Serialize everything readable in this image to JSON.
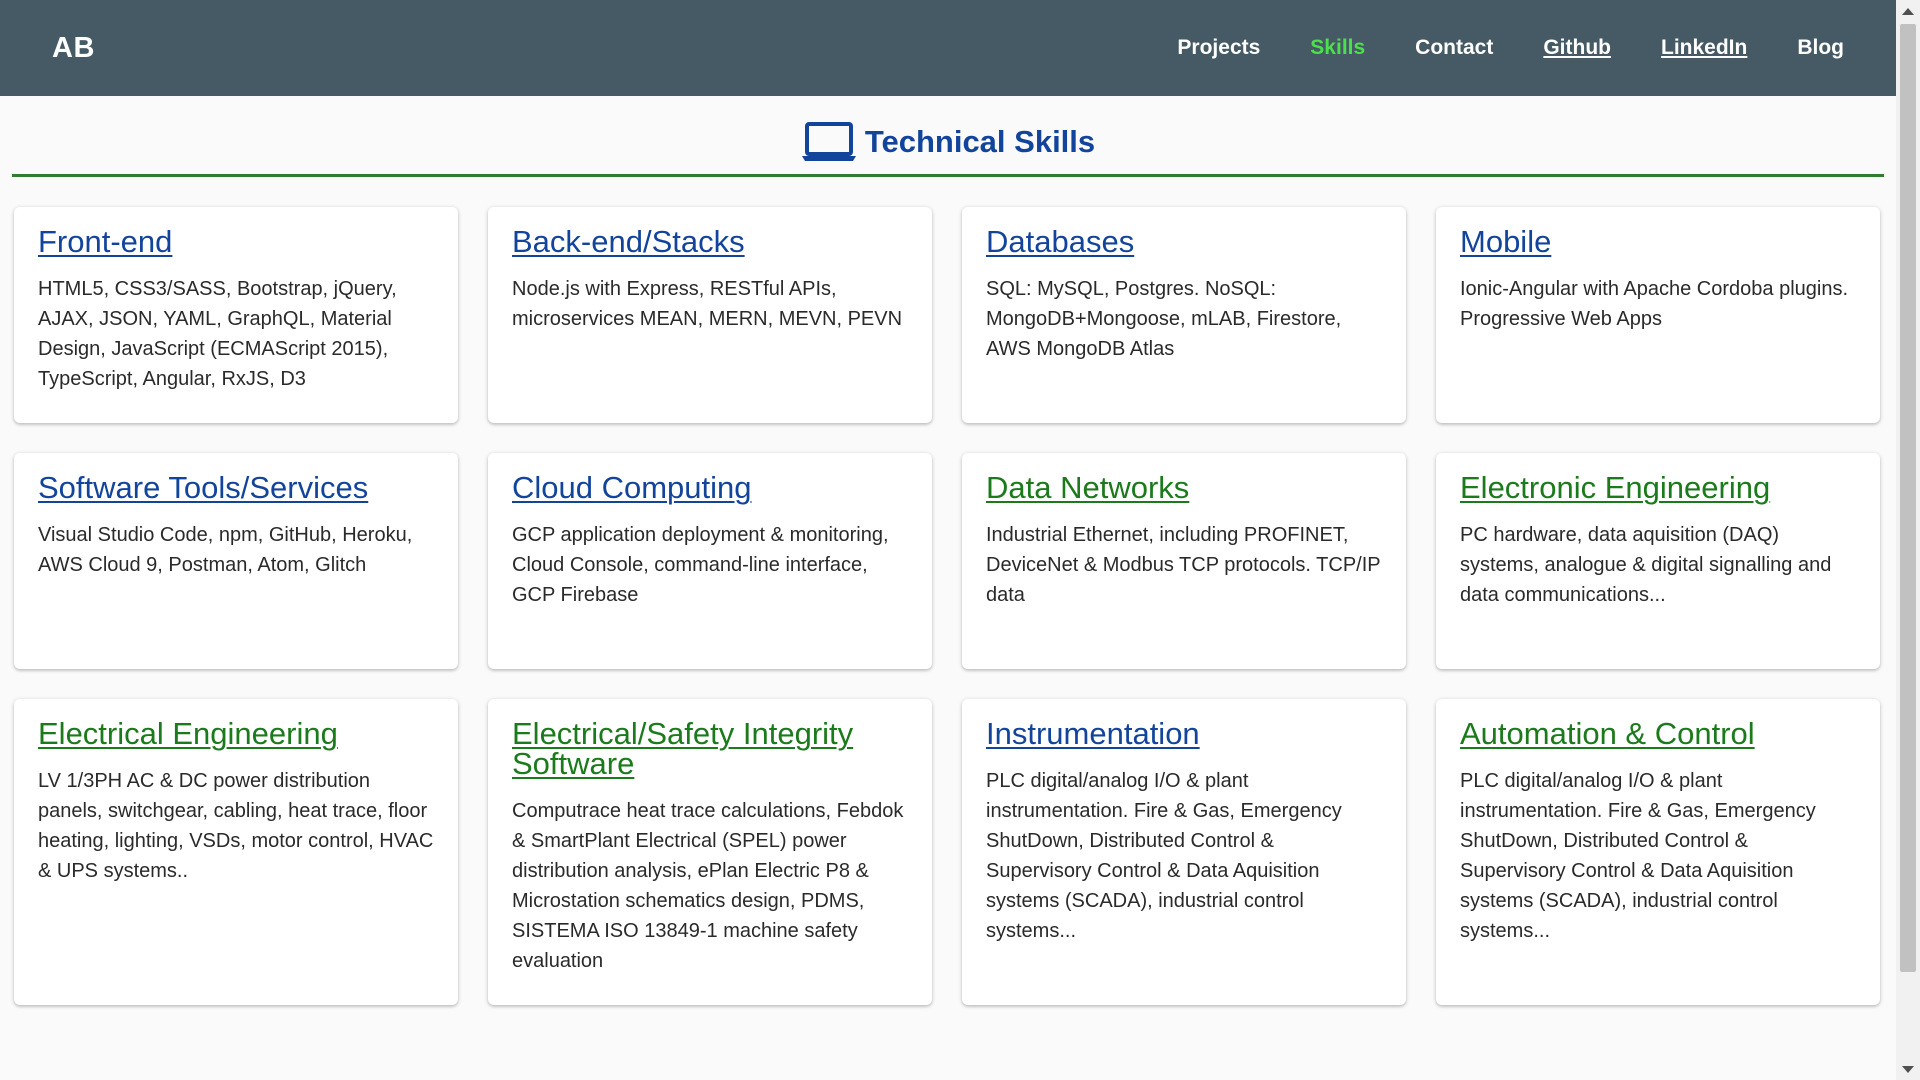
{
  "brand": "AB",
  "nav": {
    "projects": "Projects",
    "skills": "Skills",
    "contact": "Contact",
    "github": "Github",
    "linkedin": "LinkedIn",
    "blog": "Blog"
  },
  "section": {
    "icon": "laptop-icon",
    "title": "Technical Skills"
  },
  "colors": {
    "navbar": "#455a64",
    "active_nav": "#4ce04c",
    "title_blue": "#13449b",
    "title_green": "#1b7a1b",
    "divider": "#2e7d32"
  },
  "cards": [
    {
      "title": "Front-end",
      "text": "HTML5, CSS3/SASS, Bootstrap, jQuery, AJAX, JSON, YAML, GraphQL, Material Design, JavaScript (ECMAScript 2015), TypeScript, Angular, RxJS, D3"
    },
    {
      "title": "Back-end/Stacks",
      "text": "Node.js with Express, RESTful APIs, microservices MEAN, MERN, MEVN, PEVN"
    },
    {
      "title": "Databases",
      "text": "SQL: MySQL, Postgres. NoSQL: MongoDB+Mongoose, mLAB, Firestore, AWS MongoDB Atlas"
    },
    {
      "title": "Mobile",
      "text": "Ionic-Angular with Apache Cordoba plugins. Progressive Web Apps"
    },
    {
      "title": "Software Tools/Services",
      "text": "Visual Studio Code, npm, GitHub, Heroku, AWS Cloud 9, Postman, Atom, Glitch"
    },
    {
      "title": "Cloud Computing",
      "text": "GCP application deployment & monitoring, Cloud Console, command-line interface, GCP Firebase"
    },
    {
      "title": "Data Networks",
      "text": "Industrial Ethernet, including PROFINET, DeviceNet & Modbus TCP protocols. TCP/IP data"
    },
    {
      "title": "Electronic Engineering",
      "text": "PC hardware, data aquisition (DAQ) systems, analogue & digital signalling and data communications..."
    },
    {
      "title": "Electrical Engineering",
      "text": "LV 1/3PH AC & DC power distribution panels, switchgear, cabling, heat trace, floor heating, lighting, VSDs, motor control, HVAC & UPS systems.."
    },
    {
      "title": "Electrical/Safety Integrity Software",
      "text": "Computrace heat trace calculations, Febdok & SmartPlant Electrical (SPEL) power distribution analysis, ePlan Electric P8 & Microstation schematics design, PDMS, SISTEMA ISO 13849-1 machine safety evaluation"
    },
    {
      "title": "Instrumentation",
      "text": "PLC digital/analog I/O & plant instrumentation. Fire & Gas, Emergency ShutDown, Distributed Control & Supervisory Control & Data Aquisition systems (SCADA), industrial control systems..."
    },
    {
      "title": "Automation & Control",
      "text": "PLC digital/analog I/O & plant instrumentation. Fire & Gas, Emergency ShutDown, Distributed Control & Supervisory Control & Data Aquisition systems (SCADA), industrial control systems..."
    }
  ]
}
